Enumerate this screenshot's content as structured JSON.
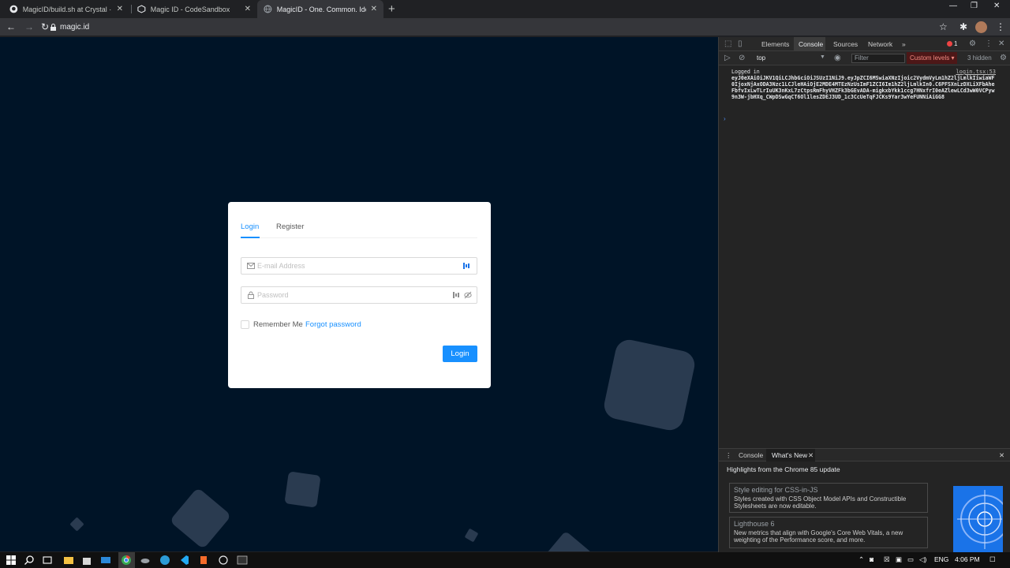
{
  "browser": {
    "tabs": [
      {
        "label": "MagicID/build.sh at Crystal · Fore",
        "icon": "github-icon"
      },
      {
        "label": "Magic ID - CodeSandbox",
        "icon": "codesandbox-icon"
      },
      {
        "label": "MagicID - One. Common. Identit",
        "icon": "globe-icon"
      }
    ],
    "url": "magic.id"
  },
  "login_card": {
    "tab_login": "Login",
    "tab_register": "Register",
    "email_placeholder": "E-mail Address",
    "password_placeholder": "Password",
    "remember_label": "Remember Me",
    "forgot_label": "Forgot password",
    "submit_label": "Login"
  },
  "devtools": {
    "tabs": [
      "Elements",
      "Console",
      "Sources",
      "Network"
    ],
    "more_tabs": "»",
    "error_count": "1",
    "context": "top",
    "filter_placeholder": "Filter",
    "levels_label": "Custom levels ▾",
    "hidden_label": "3 hidden",
    "log_prefix": "Logged in",
    "log_source": "login.tsx:53",
    "log_token": "eyJ0eXAiOiJKV1QiLCJhbGciOiJSUzI1NiJ9.eyJpZCI6MSwiaXNzIjoic2VydmVyLm1hZ2ljLmlkIiwiaWF0IjoxNjAxODA3Nzc1LCJleHAiOjE2MDE4MTEzNzUsImF1ZCI6Im1hZ2ljLmlkIn0.C6PFSXnLzDXLiXFbAheFbfvIxLwTLrIuUK3nKxL7zCtpsRmFhyVHZFk3bGEvADA-migkxbYkk1ccg7HNxfrI0eAZlewLCd3wW0VCPyw9n3W-jbHXq_CWpDSwGqCT6Ol1lesZDEJ3UD_1c3CcUeTqFJCKs9Yar3wYeFUNNiAiGG8",
    "drawer_tabs": [
      "Console",
      "What's New"
    ],
    "highlights": "Highlights from the Chrome 85 update",
    "news": [
      {
        "title": "Style editing for CSS-in-JS",
        "desc": "Styles created with CSS Object Model APIs and Constructible Stylesheets are now editable."
      },
      {
        "title": "Lighthouse 6",
        "desc": "New metrics that align with Google's Core Web Vitals, a new weighting of the Performance score, and more."
      }
    ]
  },
  "taskbar": {
    "language": "ENG",
    "time": "4:06 PM"
  }
}
